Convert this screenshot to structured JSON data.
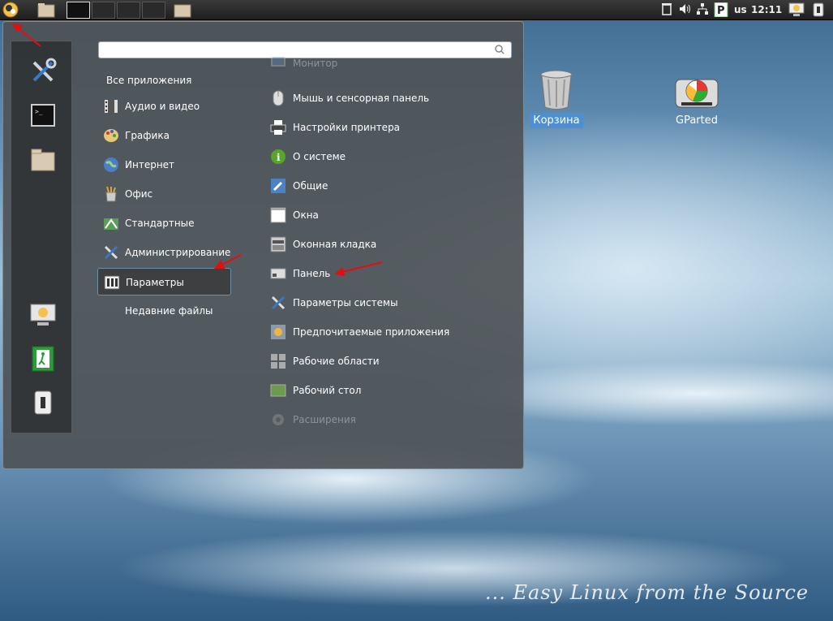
{
  "topbar": {
    "menu_icon": "calculate-logo-icon",
    "workspaces": 4,
    "tray": {
      "keyboard_layout": "us",
      "time": "12:11"
    }
  },
  "menu": {
    "search": {
      "value": "",
      "placeholder": ""
    },
    "all_apps_label": "Все приложения",
    "categories": [
      {
        "label": "Аудио и видео",
        "icon": "film-icon"
      },
      {
        "label": "Графика",
        "icon": "palette-icon"
      },
      {
        "label": "Интернет",
        "icon": "globe-icon"
      },
      {
        "label": "Офис",
        "icon": "office-icon"
      },
      {
        "label": "Стандартные",
        "icon": "accessories-icon"
      },
      {
        "label": "Администрирование",
        "icon": "tools-icon"
      },
      {
        "label": "Параметры",
        "icon": "settings-icon",
        "selected": true
      },
      {
        "label": "Недавние файлы",
        "icon": ""
      }
    ],
    "apps": [
      {
        "label": "Монитор",
        "icon": "monitor-icon"
      },
      {
        "label": "Мышь и сенсорная панель",
        "icon": "mouse-icon"
      },
      {
        "label": "Настройки принтера",
        "icon": "printer-icon"
      },
      {
        "label": "О системе",
        "icon": "info-icon"
      },
      {
        "label": "Общие",
        "icon": "wrench-icon"
      },
      {
        "label": "Окна",
        "icon": "window-icon"
      },
      {
        "label": "Оконная кладка",
        "icon": "tiling-icon"
      },
      {
        "label": "Панель",
        "icon": "panel-icon"
      },
      {
        "label": "Параметры системы",
        "icon": "tools-icon"
      },
      {
        "label": "Предпочитаемые приложения",
        "icon": "preferred-apps-icon"
      },
      {
        "label": "Рабочие области",
        "icon": "workspaces-icon"
      },
      {
        "label": "Рабочий стол",
        "icon": "desktop-icon"
      },
      {
        "label": "Расширения",
        "icon": "extensions-icon"
      }
    ]
  },
  "desktop": {
    "icons": [
      {
        "label": "Корзина",
        "icon": "trash-icon",
        "selected": true
      },
      {
        "label": "GParted",
        "icon": "gparted-icon",
        "selected": false
      }
    ],
    "tagline": "... Easy Linux from the Source"
  },
  "colors": {
    "selection": "#4d8fd0",
    "menu_bg": "#4e5256",
    "arrow": "#e01010"
  }
}
